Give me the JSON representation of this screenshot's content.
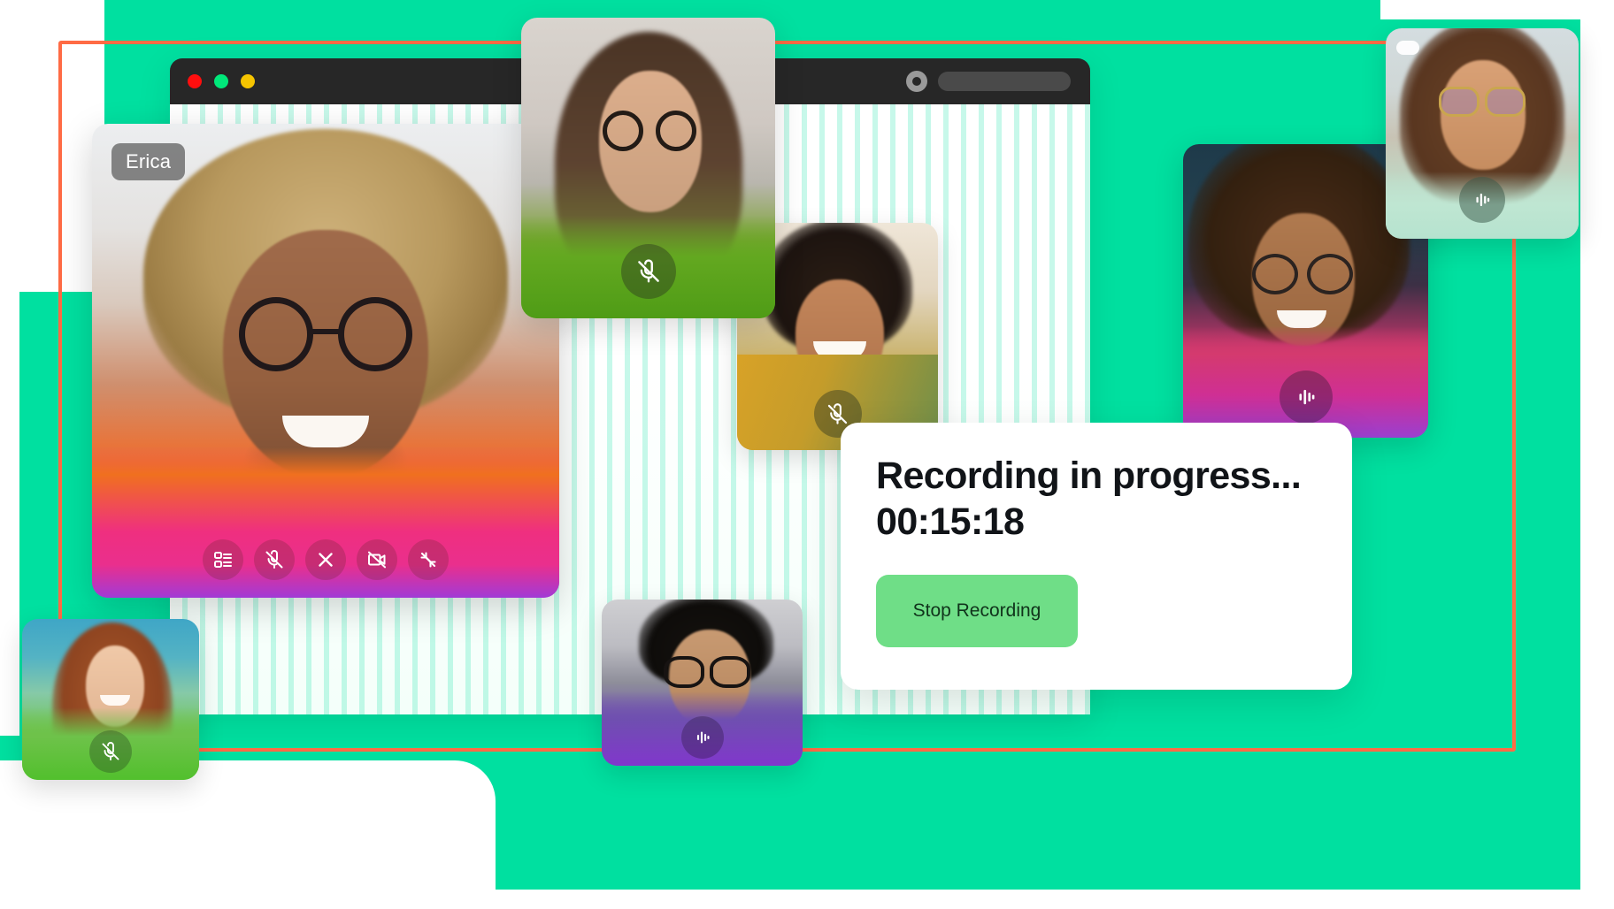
{
  "theme": {
    "background_teal": "#00E0A0",
    "frame_orange": "#FF6B45",
    "panel_white": "#FFFFFF",
    "stop_button_green": "#6FDE87",
    "titlebar_dark": "#272727"
  },
  "browser_window": {
    "traffic_lights": [
      {
        "name": "close",
        "color": "#FF0E0E"
      },
      {
        "name": "minimize",
        "color": "#00E87A"
      },
      {
        "name": "maximize",
        "color": "#F5C400"
      }
    ],
    "record_indicator_icon": "record-circle-icon",
    "address_pill": {
      "value": "",
      "placeholder": ""
    }
  },
  "main_video": {
    "participant_name": "Erica",
    "controls": [
      {
        "name": "layout-view-button",
        "icon": "layout-list-icon",
        "label": "Layout"
      },
      {
        "name": "mute-mic-button",
        "icon": "mic-off-icon",
        "label": "Mute"
      },
      {
        "name": "end-call-button",
        "icon": "close-x-icon",
        "label": "End call"
      },
      {
        "name": "stop-video-button",
        "icon": "video-off-icon",
        "label": "Stop video"
      },
      {
        "name": "collapse-button",
        "icon": "collapse-arrows-icon",
        "label": "Collapse"
      }
    ]
  },
  "participants": [
    {
      "id": "p-top-center",
      "name": "",
      "status_icon": "mic-off-icon",
      "muted": true
    },
    {
      "id": "p-mid-center",
      "name": "",
      "status_icon": "mic-off-icon",
      "muted": true
    },
    {
      "id": "p-right-upper",
      "name": "",
      "status_icon": "audio-wave-icon",
      "muted": false,
      "badge": "pinned-badge"
    },
    {
      "id": "p-right-mid",
      "name": "",
      "status_icon": "audio-wave-icon",
      "muted": false
    },
    {
      "id": "p-bottom-center",
      "name": "",
      "status_icon": "audio-wave-icon",
      "muted": false
    },
    {
      "id": "p-bottom-left",
      "name": "",
      "status_icon": "mic-off-icon",
      "muted": true
    }
  ],
  "recording_panel": {
    "title": "Recording in progress...",
    "elapsed_time": "00:15:18",
    "stop_button_label": "Stop Recording"
  }
}
